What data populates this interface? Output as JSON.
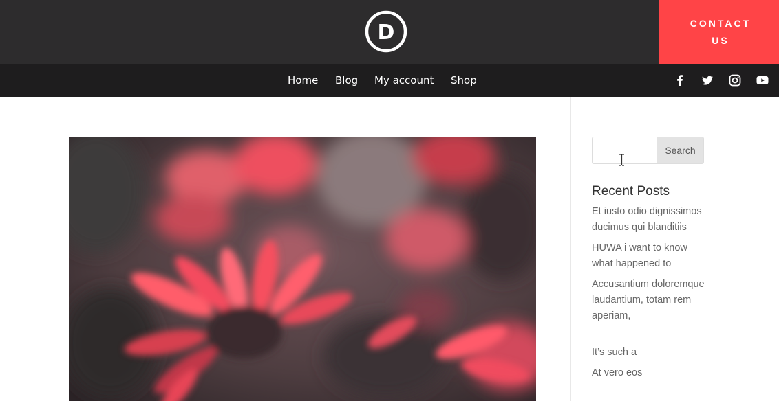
{
  "header": {
    "logo_letter": "D",
    "contact_label": "CONTACT US",
    "colors": {
      "header_bg": "#2d2c2d",
      "nav_bg": "#1e1d1e",
      "accent": "#ff4447"
    }
  },
  "nav": {
    "items": [
      {
        "label": "Home"
      },
      {
        "label": "Blog"
      },
      {
        "label": "My account"
      },
      {
        "label": "Shop"
      }
    ],
    "social_icons": [
      "facebook-icon",
      "twitter-icon",
      "instagram-icon",
      "youtube-icon"
    ]
  },
  "main": {
    "featured_image_icon": "flower-photo"
  },
  "sidebar": {
    "search": {
      "placeholder": "",
      "button_label": "Search"
    },
    "recent_posts_title": "Recent Posts",
    "recent_posts": [
      {
        "title": "Et iusto odio dignissimos ducimus qui blanditiis"
      },
      {
        "title": "HUWA i want to know what happened to"
      },
      {
        "title": "Accusantium doloremque laudantium, totam rem aperiam,"
      },
      {
        "title": "It’s such a"
      },
      {
        "title": "At vero eos"
      }
    ]
  }
}
